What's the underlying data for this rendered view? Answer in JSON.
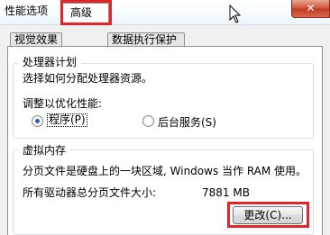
{
  "window": {
    "title": "性能选项",
    "close_label": "✕"
  },
  "tabs": {
    "visual_effects": "视觉效果",
    "advanced": "高级",
    "dep": "数据执行保护"
  },
  "processor": {
    "legend": "处理器计划",
    "description": "选择如何分配处理器资源。",
    "adjust_label": "调整以优化性能:",
    "options": [
      {
        "label": "程序(P)",
        "checked": true
      },
      {
        "label": "后台服务(S)",
        "checked": false
      }
    ]
  },
  "virtual_memory": {
    "legend": "虚拟内存",
    "description": "分页文件是硬盘上的一块区域, Windows 当作 RAM 使用。",
    "total_label": "所有驱动器总分页文件大小:",
    "total_value": "7881 MB",
    "change_button": "更改(C)..."
  },
  "highlights": {
    "color": "#e0262a"
  }
}
